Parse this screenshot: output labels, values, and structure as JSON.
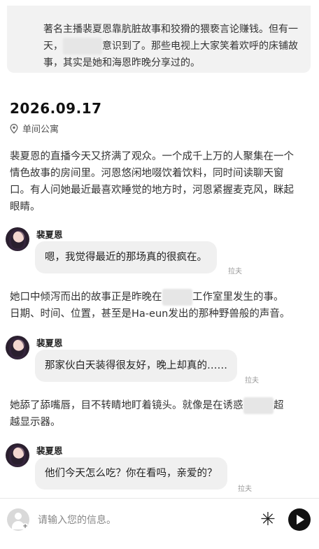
{
  "summary": {
    "line1": "著名主播裴夏恩靠肮脏故事和狡猾的猥亵言论赚钱。但有一",
    "line2_pre": "天，",
    "line2_post": "意识到了。那些电视上大家笑着欢呼的床铺故",
    "line3": "事，其实是她和海恩昨晚分享过的。"
  },
  "entry": {
    "date": "2026.09.17",
    "location_icon": "location-pin-icon",
    "location": "单间公寓"
  },
  "narration": {
    "p1_l1": "裴夏恩的直播今天又挤满了观众。一个成千上万的人聚集在一个",
    "p1_l2": "情色故事的房间里。河恩悠闲地啜饮着饮料，同时间读聊天窗",
    "p1_l3": "口。有人问她最近最喜欢睡觉的地方时，河恩紧握麦克风，眯起",
    "p1_l4": "眼睛。",
    "p2_l1_pre": "她口中倾泻而出的故事正是昨晚在",
    "p2_l1_post": "工作室里发生的事。",
    "p2_l2": "日期、时间、位置，甚至是Ha-eun发出的那种野兽般的声音。",
    "p3_l1_pre": "她舔了舔嘴唇，目不转睛地盯着镜头。就像是在诱惑",
    "p3_l1_post": "超",
    "p3_l2": "越显示器。"
  },
  "messages": [
    {
      "sender": "裴夏恩",
      "text": "嗯，我觉得最近的那场真的很疯在。",
      "tag": "拉夫"
    },
    {
      "sender": "裴夏恩",
      "text": "那家伙白天装得很友好，晚上却真的……",
      "tag": "拉夫"
    },
    {
      "sender": "裴夏恩",
      "text": "他们今天怎么吃？你在看吗，亲爱的？",
      "tag": "拉夫"
    }
  ],
  "input_bar": {
    "placeholder": "请输入您的信息。",
    "spark_glyph": "✳",
    "send_icon": "play-send-icon"
  }
}
